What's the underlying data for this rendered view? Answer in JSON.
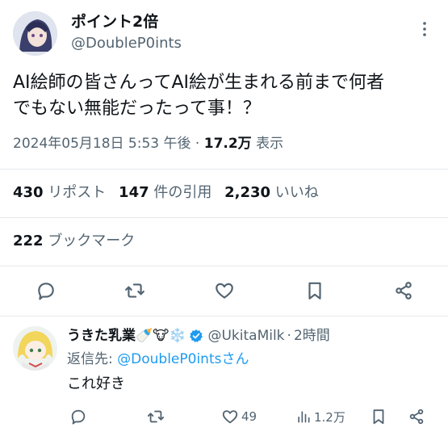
{
  "tweet": {
    "author_name": "ポイント2倍",
    "author_handle": "@DoubleP0ints",
    "text_line1": "AI絵師の皆さんってAI絵が生まれる前まで何者",
    "text_line2": "でもない無能だったって事！？",
    "datetime": "2024年05月18日 5:53 午後",
    "dot": "·",
    "views_value": "17.2万",
    "views_label": "表示",
    "stats": {
      "reposts_value": "430",
      "reposts_label": "リポスト",
      "quotes_value": "147",
      "quotes_label": "件の引用",
      "likes_value": "2,230",
      "likes_label": "いいね",
      "bookmarks_value": "222",
      "bookmarks_label": "ブックマーク"
    },
    "more_icon": "more-vertical-icon"
  },
  "reply": {
    "author_name": "うきた乳業🍼🐮❄️",
    "verified": true,
    "author_handle": "@UkitaMilk",
    "dot": "·",
    "time": "2時間",
    "reply_to_prefix": "返信先: ",
    "reply_to_handle": "@DoubleP0intsさん",
    "text": "これ好き",
    "likes_count": "49",
    "views_count": "1.2万"
  },
  "colors": {
    "accent": "#1d9bf0",
    "muted": "#536471",
    "text": "#0f1419",
    "divider": "#e6eaed"
  }
}
